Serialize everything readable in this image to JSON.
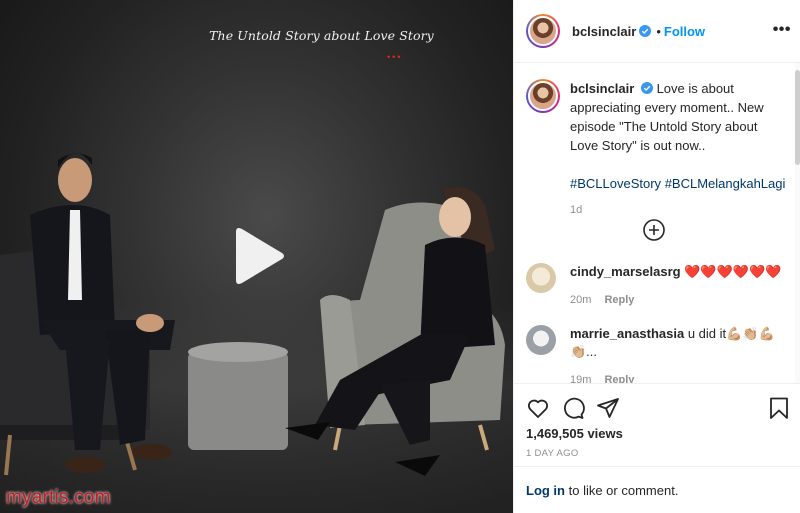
{
  "video": {
    "title": "The Untold Story about Love Story",
    "dots": "•••"
  },
  "watermark": "myartis.com",
  "header": {
    "username": "bclsinclair",
    "separator": "•",
    "follow_label": "Follow",
    "more_label": "•••"
  },
  "caption": {
    "username": "bclsinclair",
    "text": "Love is about appreciating every moment.. New episode \"The Untold Story about Love Story\" is out now..",
    "hashtags": [
      "#BCLLoveStory",
      "#BCLMelangkahLagi"
    ],
    "time": "1d"
  },
  "comments": [
    {
      "username": "cindy_marselasrg",
      "text": "❤️❤️❤️❤️❤️❤️",
      "time": "20m",
      "reply_label": "Reply"
    },
    {
      "username": "marrie_anasthasia",
      "text": "u did it💪🏼👏🏼💪🏼👏🏼...",
      "time": "19m",
      "reply_label": "Reply"
    }
  ],
  "stats": {
    "views": "1,469,505 views",
    "date": "1 DAY AGO"
  },
  "login": {
    "link_label": "Log in",
    "rest_text": " to like or comment."
  },
  "colors": {
    "accent": "#0095f6",
    "link": "#00376b",
    "heart": "#d0161c",
    "watermark": "#d0161c"
  }
}
